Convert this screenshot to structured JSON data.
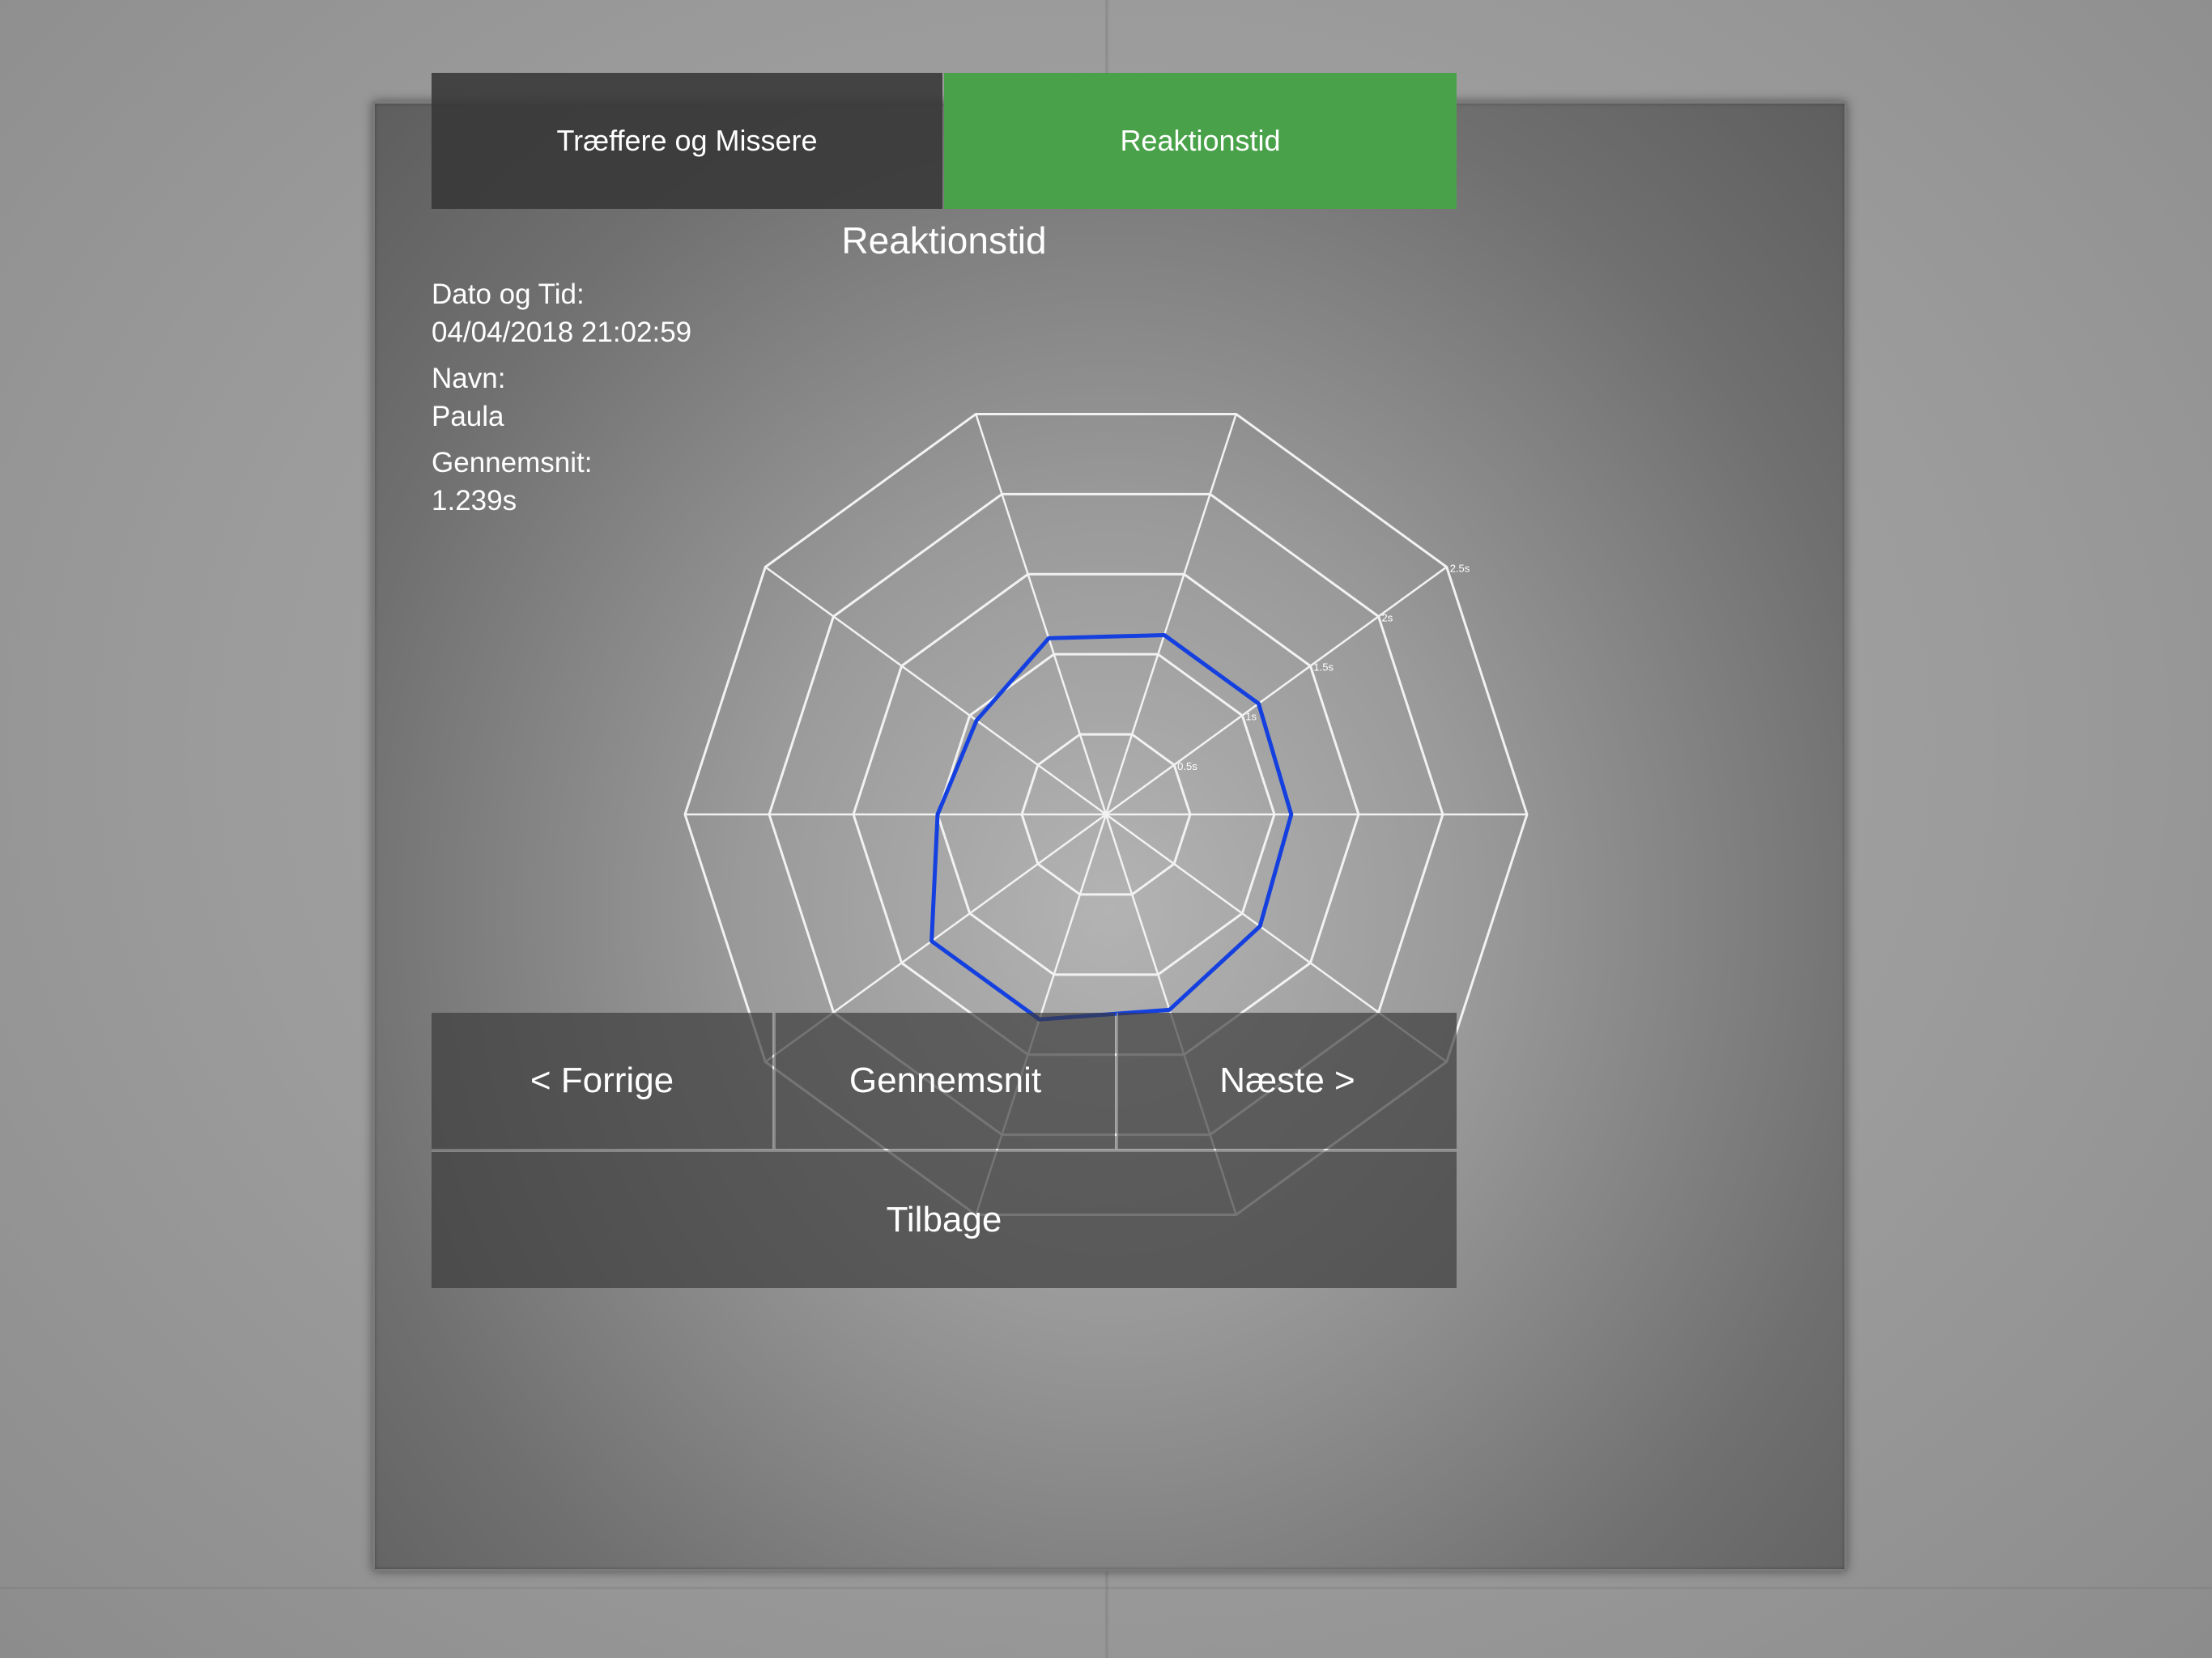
{
  "tabs": {
    "hits_misses": "Træffere og Missere",
    "reaction_time": "Reaktionstid"
  },
  "page_title": "Reaktionstid",
  "info": {
    "date_label": "Dato og Tid:",
    "date_value": "04/04/2018 21:02:59",
    "name_label": "Navn:",
    "name_value": "Paula",
    "average_label": "Gennemsnit:",
    "average_value": "1.239s"
  },
  "buttons": {
    "previous": "< Forrige",
    "average": "Gennemsnit",
    "next": "Næste >",
    "back": "Tilbage"
  },
  "colors": {
    "active_tab": "#49a24a",
    "series_line": "#1540e0",
    "grid": "#f2f2f2"
  },
  "chart_data": {
    "type": "radar",
    "axes_count": 10,
    "ring_values": [
      0.5,
      1,
      1.5,
      2,
      2.5
    ],
    "ring_labels": [
      "0.5s",
      "1s",
      "1.5s",
      "2s",
      "2.5s"
    ],
    "series": [
      {
        "values": [
          1.12,
          1.12,
          1.1,
          1.13,
          1.22,
          1.28,
          1.28,
          1.0,
          0.95,
          1.1
        ]
      }
    ]
  }
}
